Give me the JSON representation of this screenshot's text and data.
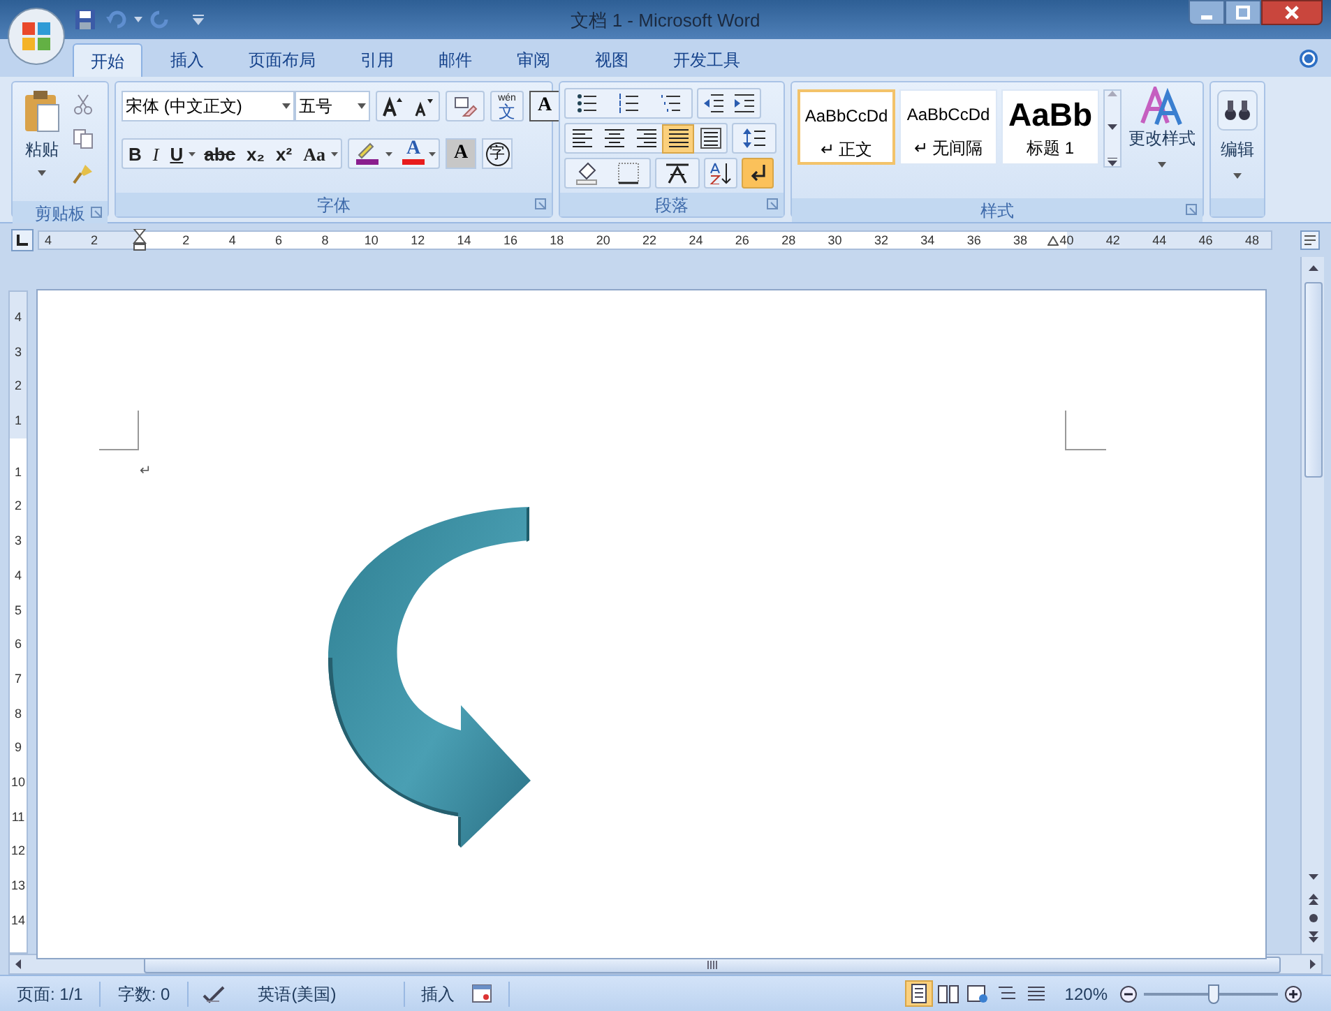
{
  "window": {
    "title": "文档 1 - Microsoft Word"
  },
  "tabs": [
    {
      "label": "开始",
      "selected": true
    },
    {
      "label": "插入",
      "selected": false
    },
    {
      "label": "页面布局",
      "selected": false
    },
    {
      "label": "引用",
      "selected": false
    },
    {
      "label": "邮件",
      "selected": false
    },
    {
      "label": "审阅",
      "selected": false
    },
    {
      "label": "视图",
      "selected": false
    },
    {
      "label": "开发工具",
      "selected": false
    }
  ],
  "clipboard": {
    "paste": "粘贴",
    "label": "剪贴板"
  },
  "font": {
    "name": "宋体 (中文正文)",
    "size": "五号",
    "phonetic_top": "wén",
    "phonetic_bottom": "文",
    "border_char": "A",
    "shading_char": "A",
    "enclosed_char": "字",
    "font_color_char": "A",
    "label": "字体",
    "format_buttons": [
      {
        "label": "B",
        "kind": "bold"
      },
      {
        "label": "I",
        "kind": "italic"
      },
      {
        "label": "U",
        "kind": "underline"
      },
      {
        "label": "abc",
        "kind": "strike"
      },
      {
        "label": "x₂",
        "kind": "sub"
      },
      {
        "label": "x²",
        "kind": "sup"
      },
      {
        "label": "Aa",
        "kind": "case"
      }
    ]
  },
  "paragraph": {
    "label": "段落",
    "alignments": [
      {
        "kind": "left",
        "selected": false
      },
      {
        "kind": "center",
        "selected": false
      },
      {
        "kind": "right",
        "selected": false
      },
      {
        "kind": "justify",
        "selected": true
      },
      {
        "kind": "distributed",
        "selected": false
      }
    ],
    "show_marks": {
      "on": true
    }
  },
  "styles": {
    "label": "样式",
    "change_styles": "更改样式",
    "items": [
      {
        "preview": "AaBbCcDd",
        "name": "↵ 正文",
        "kind": "normal",
        "selected": true
      },
      {
        "preview": "AaBbCcDd",
        "name": "↵ 无间隔",
        "kind": "normal",
        "selected": false
      },
      {
        "preview": "AaBb",
        "name": "标题 1",
        "kind": "heading",
        "selected": false
      }
    ]
  },
  "editing": {
    "label": "编辑"
  },
  "ruler": {
    "left_labels": [
      "4",
      "2"
    ],
    "right_labels": [
      "2",
      "4",
      "6",
      "8",
      "10",
      "12",
      "14",
      "16",
      "18",
      "20",
      "22",
      "24",
      "26",
      "28",
      "30",
      "32",
      "34",
      "36",
      "38",
      "40",
      "42",
      "44",
      "46",
      "48"
    ]
  },
  "vruler": {
    "top_labels": [
      "4",
      "3",
      "2",
      "1"
    ],
    "body_labels": [
      "1",
      "2",
      "3",
      "4",
      "5",
      "6",
      "7",
      "8",
      "9",
      "10",
      "11",
      "12",
      "13",
      "14"
    ]
  },
  "document": {
    "paragraph_mark": "↵"
  },
  "status_bar": {
    "page": "页面: 1/1",
    "words": "字数: 0",
    "language": "英语(美国)",
    "mode": "插入",
    "zoom": "120%",
    "zoom_level": {
      "level": 0.52
    },
    "views": [
      {
        "kind": "print",
        "selected": true
      },
      {
        "kind": "read",
        "selected": false
      },
      {
        "kind": "web",
        "selected": false
      },
      {
        "kind": "outline",
        "selected": false
      },
      {
        "kind": "draft",
        "selected": false
      }
    ]
  }
}
